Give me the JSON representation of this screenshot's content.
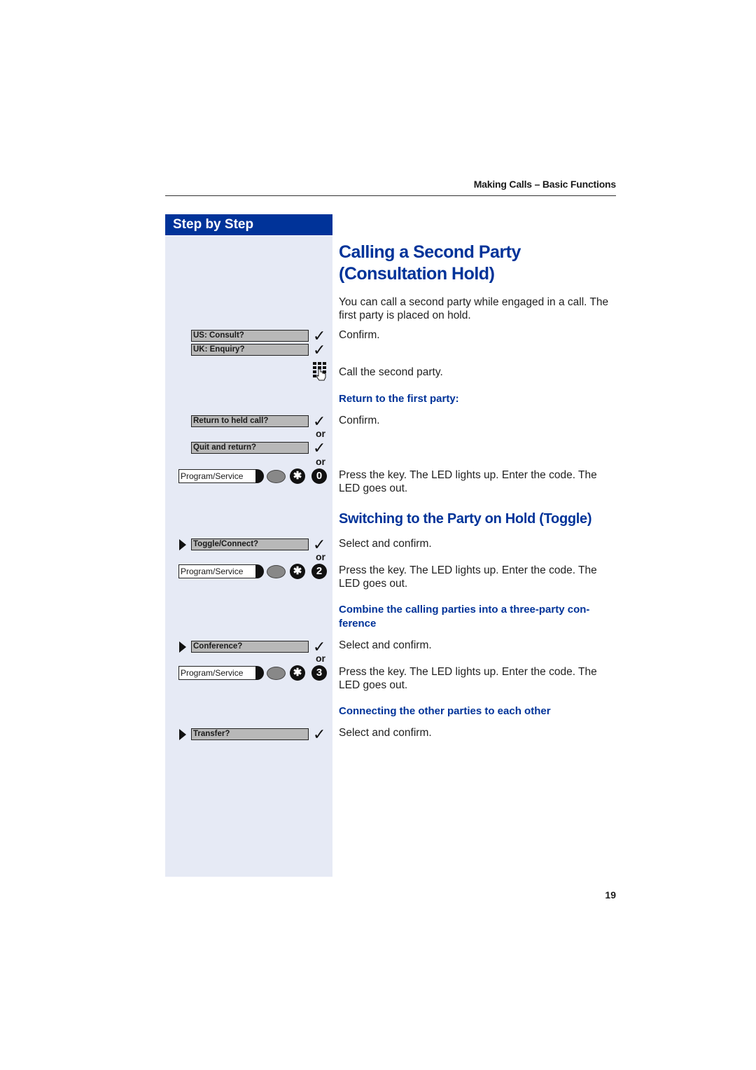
{
  "header": {
    "running_title": "Making Calls – Basic Functions"
  },
  "sidebar": {
    "title": "Step by Step",
    "display_items": {
      "us_consult": "US: Consult?",
      "uk_enquiry": "UK: Enquiry?",
      "return_held": "Return to held call?",
      "quit_return": "Quit and return?",
      "toggle": "Toggle/Connect?",
      "conference": "Conference?",
      "transfer": "Transfer?"
    },
    "program_key_label": "Program/Service",
    "or_label": "or",
    "key_star": "✱",
    "key_0": "0",
    "key_2": "2",
    "key_3": "3"
  },
  "main": {
    "title_line1": "Calling a Second Party",
    "title_line2": "(Consultation Hold)",
    "intro": "You can call a second party while engaged in a call. The first party is placed on hold.",
    "confirm": "Confirm.",
    "call_second": "Call the second party.",
    "return_heading": "Return to the first party:",
    "confirm2": "Confirm.",
    "press_key_1": "Press the key. The LED lights up. Enter the code. The LED goes out.",
    "toggle_title": "Switching to the Party on Hold (Toggle)",
    "select_confirm_1": "Select and confirm.",
    "press_key_2": "Press the key. The LED lights up. Enter the code. The LED goes out.",
    "conference_heading": "Combine the calling parties into a three-party con- ference",
    "select_confirm_2": "Select and confirm.",
    "press_key_3": "Press the key. The LED lights up. Enter the code. The LED goes out.",
    "connect_heading": "Connecting the other parties to each other",
    "select_confirm_3": "Select and confirm."
  },
  "footer": {
    "page_number": "19"
  }
}
